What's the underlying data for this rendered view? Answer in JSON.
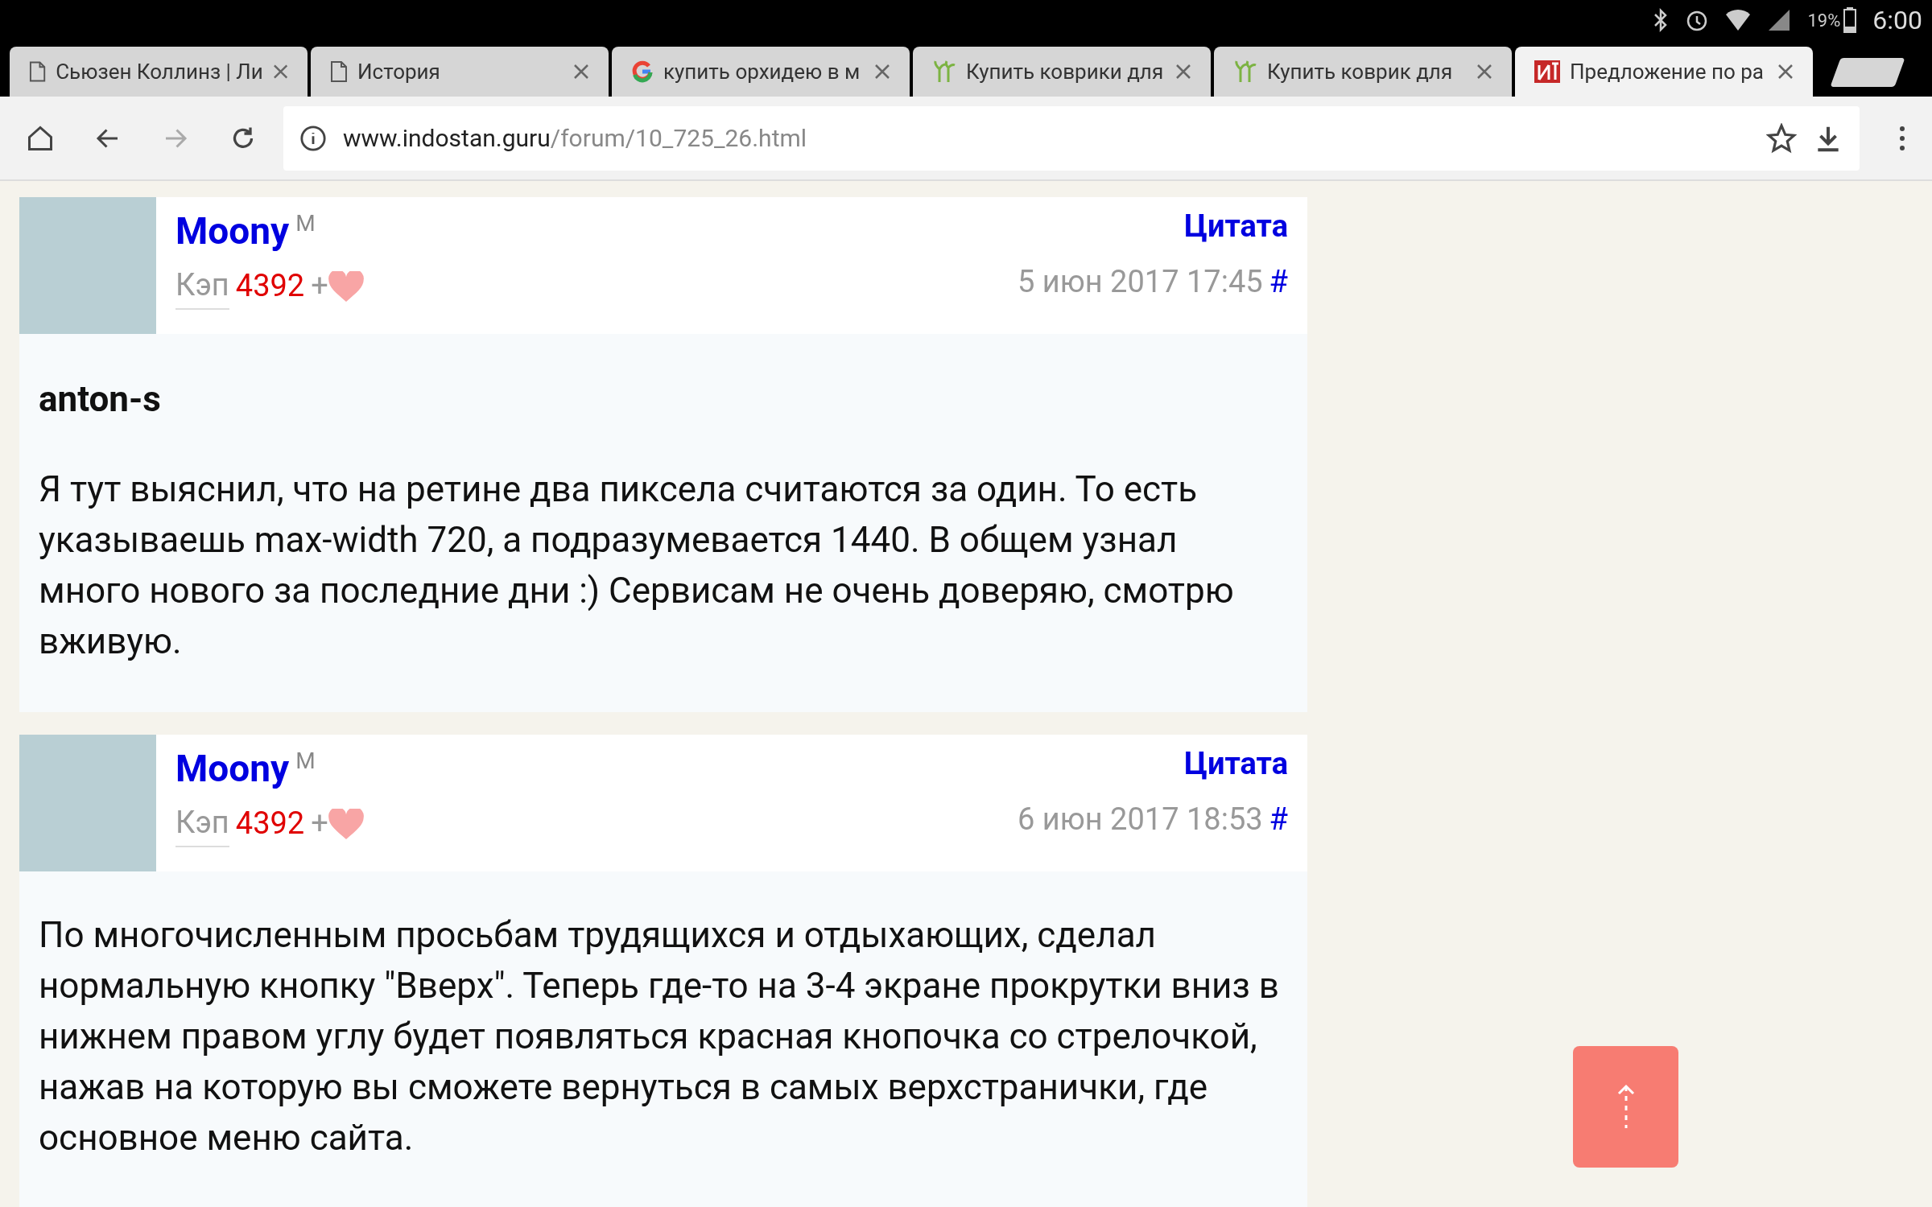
{
  "status_bar": {
    "battery": "19%",
    "time": "6:00"
  },
  "tabs": [
    {
      "title": "Сьюзен Коллинз | Ли",
      "kind": "page",
      "selected": false
    },
    {
      "title": "История",
      "kind": "page",
      "selected": false
    },
    {
      "title": "купить орхидею в м",
      "kind": "google",
      "selected": false
    },
    {
      "title": "Купить коврики для",
      "kind": "plant",
      "selected": false
    },
    {
      "title": "Купить коврик для",
      "kind": "plant",
      "selected": false
    },
    {
      "title": "Предложение по ра",
      "kind": "site",
      "selected": true
    }
  ],
  "address_bar": {
    "host": "www.indostan.guru",
    "path": "/forum/10_725_26.html"
  },
  "posts": [
    {
      "author": "Moony",
      "gender": "M",
      "rank": "Кэп",
      "karma": "4392",
      "plus": "+",
      "quote": "Цитата",
      "date": "5 июн 2017 17:45",
      "anchor": "#",
      "paragraphs": [
        {
          "text": "anton-s",
          "kind": "heading"
        },
        {
          "text": "Я тут выяснил, что на ретине два пиксела считаются за один. То есть указываешь max-width 720, а подразумевается 1440. В общем узнал много нового за последние дни :) Сервисам не очень доверяю, смотрю вживую.",
          "kind": "text"
        }
      ]
    },
    {
      "author": "Moony",
      "gender": "M",
      "rank": "Кэп",
      "karma": "4392",
      "plus": "+",
      "quote": "Цитата",
      "date": "6 июн 2017 18:53",
      "anchor": "#",
      "paragraphs": [
        {
          "text": "По многочисленным просьбам трудящихся и отдыхающих, сделал нормальную кнопку \"Вверх\". Теперь где-то на 3-4 экране прокрутки вниз в нижнем правом углу будет появляться красная кнопочка со стрелочкой, нажав на которую вы сможете вернуться в самых верхстранички, где основное меню сайта.",
          "kind": "text"
        }
      ]
    }
  ]
}
